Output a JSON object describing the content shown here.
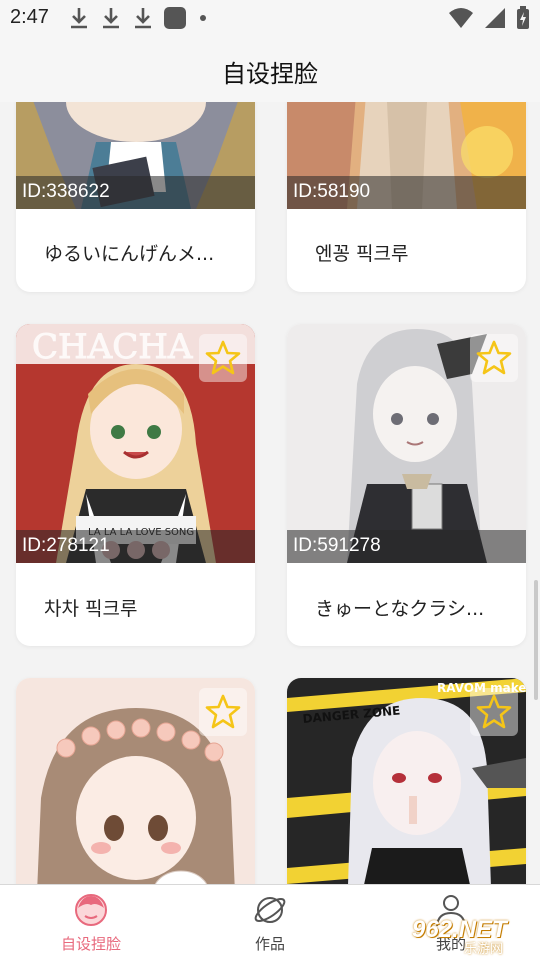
{
  "status_bar": {
    "time": "2:47",
    "icons_left": [
      "download-icon",
      "download-icon",
      "download-icon",
      "app-square-icon",
      "dot-icon"
    ],
    "icons_right": [
      "wifi-icon",
      "signal-icon",
      "battery-charging-icon"
    ]
  },
  "header": {
    "title": "自设捏脸"
  },
  "cards": [
    {
      "id": "ID:338622",
      "name": "ゆるいにんげんメ...",
      "favorite_icon": "star-outline-icon",
      "has_star": false
    },
    {
      "id": "ID:58190",
      "name": "엔꽁 픽크루",
      "favorite_icon": "star-outline-icon",
      "has_star": false
    },
    {
      "id": "ID:278121",
      "name": "차차 픽크루",
      "favorite_icon": "star-outline-icon",
      "has_star": true,
      "art_text": "LA LA LA LOVE SONG"
    },
    {
      "id": "ID:591278",
      "name": "きゅーとなクラシ...",
      "favorite_icon": "star-outline-icon",
      "has_star": true
    },
    {
      "id": "",
      "name": "",
      "favorite_icon": "star-outline-icon",
      "has_star": true
    },
    {
      "id": "",
      "name": "",
      "favorite_icon": "star-outline-icon",
      "has_star": true,
      "art_text": "RAVOM maker"
    }
  ],
  "bottom_nav": {
    "items": [
      {
        "label": "自设捏脸",
        "icon": "face-icon",
        "active": true
      },
      {
        "label": "作品",
        "icon": "planet-icon",
        "active": false
      },
      {
        "label": "我的",
        "icon": "person-icon",
        "active": false
      }
    ]
  },
  "watermark": {
    "text": "962.NET",
    "sub": "乐游网"
  },
  "colors": {
    "accent": "#e8697d",
    "star": "#f5c518",
    "id_bar": "#3a3a3a"
  }
}
